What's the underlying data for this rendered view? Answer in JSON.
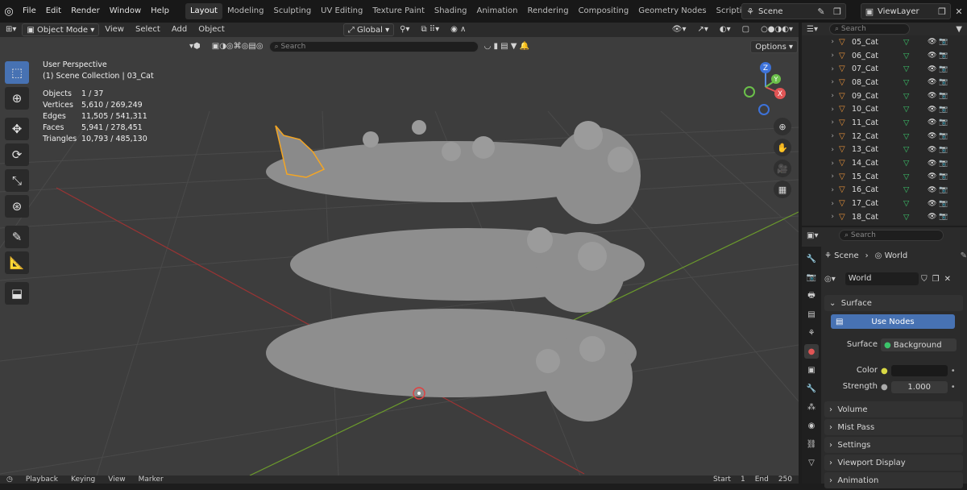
{
  "topbar": {
    "menus": [
      "File",
      "Edit",
      "Render",
      "Window",
      "Help"
    ],
    "workspaces": [
      "Layout",
      "Modeling",
      "Sculpting",
      "UV Editing",
      "Texture Paint",
      "Shading",
      "Animation",
      "Rendering",
      "Compositing",
      "Geometry Nodes",
      "Scripting"
    ],
    "active_workspace": "Layout",
    "scene": "Scene",
    "view_layer": "ViewLayer"
  },
  "viewport_header": {
    "mode": "Object Mode",
    "menus": [
      "View",
      "Select",
      "Add",
      "Object"
    ],
    "transform_orientation": "Global",
    "search_placeholder": "Search",
    "options": "Options"
  },
  "overlay": {
    "perspective": "User Perspective",
    "collection": "(1) Scene Collection | 03_Cat",
    "stats": [
      {
        "k": "Objects",
        "v": "1 / 37"
      },
      {
        "k": "Vertices",
        "v": "5,610 / 269,249"
      },
      {
        "k": "Edges",
        "v": "11,505 / 541,311"
      },
      {
        "k": "Faces",
        "v": "5,941 / 278,451"
      },
      {
        "k": "Triangles",
        "v": "10,793 / 485,130"
      }
    ]
  },
  "gizmo": {
    "z": "Z",
    "y": "Y",
    "x": "X"
  },
  "timeline": {
    "items": [
      "Playback",
      "Keying",
      "View",
      "Marker"
    ],
    "start_label": "Start",
    "start": "1",
    "end_label": "End",
    "end": "250"
  },
  "outliner": {
    "search_placeholder": "Search",
    "items": [
      "05_Cat",
      "06_Cat",
      "07_Cat",
      "08_Cat",
      "09_Cat",
      "10_Cat",
      "11_Cat",
      "12_Cat",
      "13_Cat",
      "14_Cat",
      "15_Cat",
      "16_Cat",
      "17_Cat",
      "18_Cat"
    ]
  },
  "properties": {
    "search_placeholder": "Search",
    "breadcrumb_scene": "Scene",
    "breadcrumb_world": "World",
    "world_name": "World",
    "surface_panel": "Surface",
    "use_nodes": "Use Nodes",
    "surface_label": "Surface",
    "surface_value": "Background",
    "color_label": "Color",
    "strength_label": "Strength",
    "strength_value": "1.000",
    "panels": [
      "Volume",
      "Mist Pass",
      "Settings",
      "Viewport Display",
      "Animation"
    ]
  },
  "colors": {
    "accent": "#4772b3",
    "object_orange": "#e8923a",
    "mesh_green": "#3bc36a",
    "selected_outline": "#f5a623"
  }
}
